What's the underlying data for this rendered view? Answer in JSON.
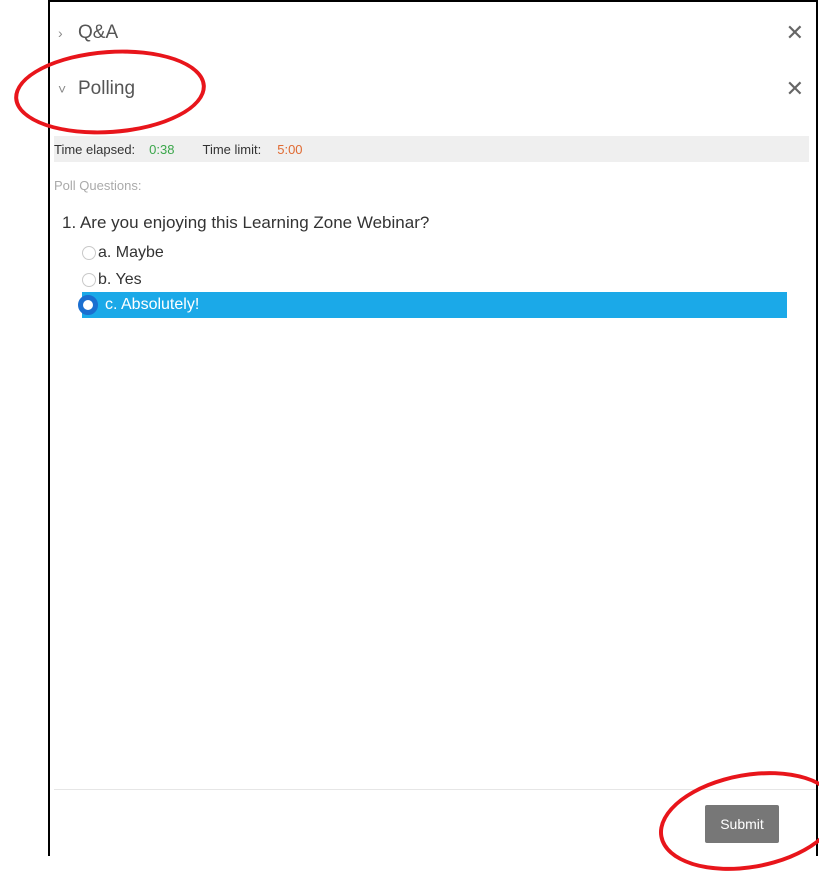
{
  "panels": {
    "qa": {
      "chevron": "›",
      "title": "Q&A",
      "close": "✕"
    },
    "polling": {
      "chevron": "˅",
      "title": "Polling",
      "close": "✕"
    }
  },
  "timer": {
    "elapsed_label": "Time elapsed:",
    "elapsed_value": "0:38",
    "limit_label": "Time limit:",
    "limit_value": "5:00"
  },
  "poll": {
    "heading": "Poll Questions:",
    "question": "1. Are you enjoying this Learning Zone Webinar?",
    "options": [
      {
        "label": "a. Maybe",
        "selected": false
      },
      {
        "label": "b. Yes",
        "selected": false
      },
      {
        "label": "c. Absolutely!",
        "selected": true
      }
    ]
  },
  "submit_label": "Submit",
  "colors": {
    "selection": "#1ba9e8",
    "radio_selected": "#1b6fd0",
    "elapsed": "#3aa64a",
    "limit": "#e06a32",
    "submit_bg": "#777777",
    "annotation": "#e8151b"
  }
}
